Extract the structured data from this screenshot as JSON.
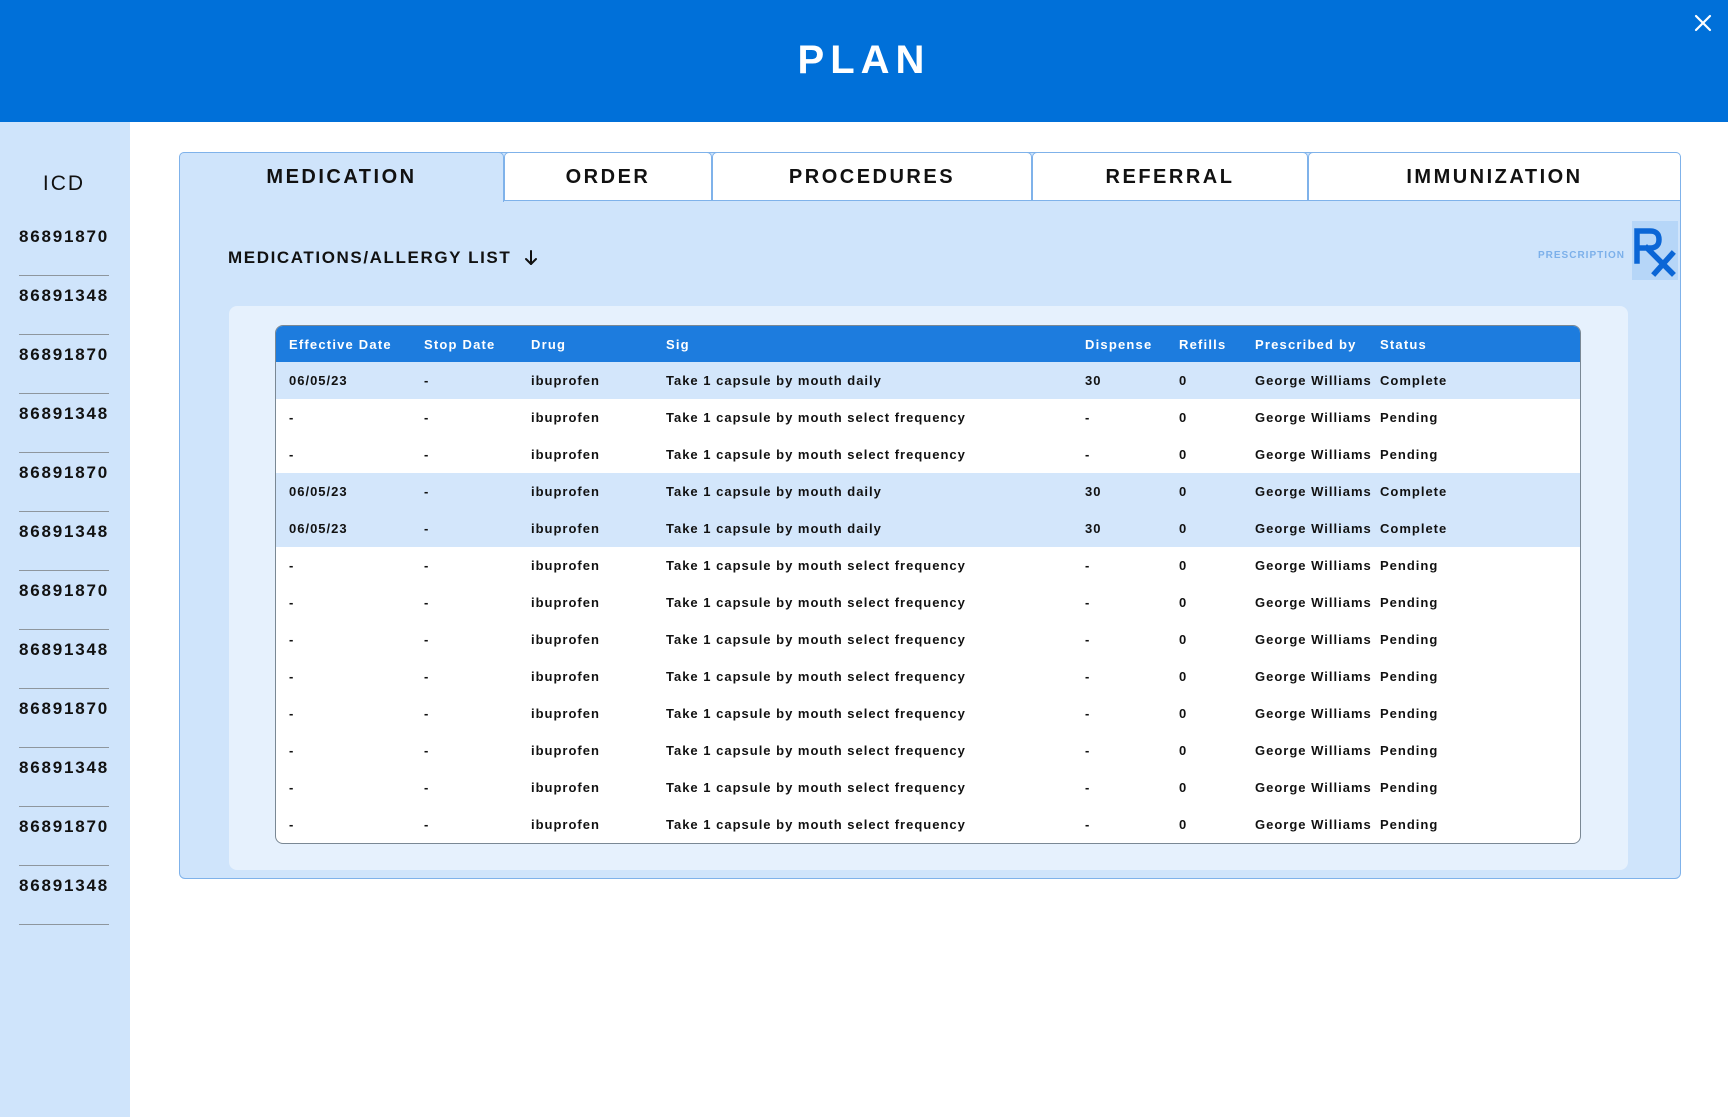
{
  "header": {
    "title": "PLAN",
    "close_icon": "close-icon"
  },
  "icd": {
    "heading": "ICD",
    "codes": [
      "86891870",
      "86891348",
      "86891870",
      "86891348",
      "86891870",
      "86891348",
      "86891870",
      "86891348",
      "86891870",
      "86891348",
      "86891870",
      "86891348"
    ]
  },
  "tabs": [
    {
      "label": "MEDICATION",
      "active": true
    },
    {
      "label": "ORDER",
      "active": false
    },
    {
      "label": "PROCEDURES",
      "active": false
    },
    {
      "label": "REFERRAL",
      "active": false
    },
    {
      "label": "IMMUNIZATION",
      "active": false
    }
  ],
  "section": {
    "title": "MEDICATIONS/ALLERGY LIST",
    "sort_icon": "arrow-down-icon"
  },
  "prescription": {
    "label": "PRESCRIPTION",
    "icon": "rx-icon"
  },
  "colors": {
    "header_bg": "#0070d9",
    "panel_bg": "#cfe4fb",
    "table_header_bg": "#1d7cde",
    "row_highlight": "#d3e6fb"
  },
  "table": {
    "columns": [
      "Effective Date",
      "Stop Date",
      "Drug",
      "Sig",
      "Dispense",
      "Refills",
      "Prescribed by",
      "Status"
    ],
    "rows": [
      [
        "06/05/23",
        "-",
        "ibuprofen",
        "Take 1 capsule by mouth daily",
        "30",
        "0",
        "George Williams",
        "Complete"
      ],
      [
        "-",
        "-",
        "ibuprofen",
        "Take 1 capsule by mouth select frequency",
        "-",
        "0",
        "George Williams",
        "Pending"
      ],
      [
        "-",
        "-",
        "ibuprofen",
        "Take 1 capsule by mouth select frequency",
        "-",
        "0",
        "George Williams",
        "Pending"
      ],
      [
        "06/05/23",
        "-",
        "ibuprofen",
        "Take 1 capsule by mouth daily",
        "30",
        "0",
        "George Williams",
        "Complete"
      ],
      [
        "06/05/23",
        "-",
        "ibuprofen",
        "Take 1 capsule by mouth daily",
        "30",
        "0",
        "George Williams",
        "Complete"
      ],
      [
        "-",
        "-",
        "ibuprofen",
        "Take 1 capsule by mouth select frequency",
        "-",
        "0",
        "George Williams",
        "Pending"
      ],
      [
        "-",
        "-",
        "ibuprofen",
        "Take 1 capsule by mouth select frequency",
        "-",
        "0",
        "George Williams",
        "Pending"
      ],
      [
        "-",
        "-",
        "ibuprofen",
        "Take 1 capsule by mouth select frequency",
        "-",
        "0",
        "George Williams",
        "Pending"
      ],
      [
        "-",
        "-",
        "ibuprofen",
        "Take 1 capsule by mouth select frequency",
        "-",
        "0",
        "George Williams",
        "Pending"
      ],
      [
        "-",
        "-",
        "ibuprofen",
        "Take 1 capsule by mouth select frequency",
        "-",
        "0",
        "George Williams",
        "Pending"
      ],
      [
        "-",
        "-",
        "ibuprofen",
        "Take 1 capsule by mouth select frequency",
        "-",
        "0",
        "George Williams",
        "Pending"
      ],
      [
        "-",
        "-",
        "ibuprofen",
        "Take 1 capsule by mouth select frequency",
        "-",
        "0",
        "George Williams",
        "Pending"
      ],
      [
        "-",
        "-",
        "ibuprofen",
        "Take 1 capsule by mouth select frequency",
        "-",
        "0",
        "George Williams",
        "Pending"
      ]
    ]
  }
}
